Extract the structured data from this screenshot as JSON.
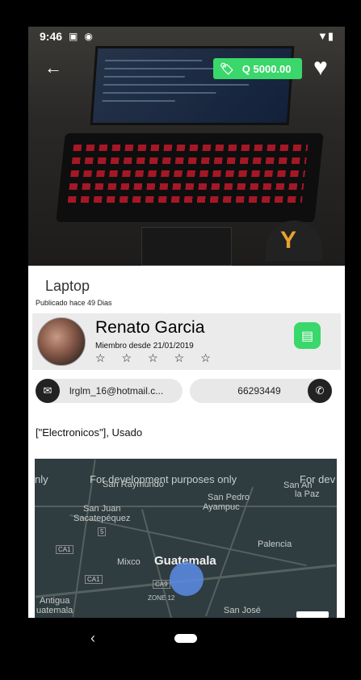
{
  "status_bar": {
    "time": "9:46",
    "icons": [
      "image-icon",
      "sync-icon"
    ],
    "right_icons": [
      "wifi-icon",
      "battery-icon"
    ]
  },
  "header": {
    "price": "Q 5000.00",
    "back_icon": "arrow-left-icon",
    "favorite_icon": "heart-icon"
  },
  "product": {
    "title": "Laptop",
    "published": "Publicado hace 49 Dias",
    "details": "[\"Electronicos\"], Usado"
  },
  "seller": {
    "name": "Renato Garcia",
    "member_since": "Miembro desde 21/01/2019",
    "stars": "☆☆☆☆☆",
    "rating_out_of": 5,
    "rating": 0
  },
  "contact": {
    "email": "lrglm_16@hotmail.c...",
    "phone": "66293449"
  },
  "map": {
    "dev_notice": "For development purposes only",
    "labels": {
      "san_raymundo": "San Raymundo",
      "san_juan": "San Juan",
      "sacatepequez": "Sacatepéquez",
      "san_pedro": "San Pedro",
      "ayampuc": "Ayampuc",
      "la_paz": "la Paz",
      "palencia": "Palencia",
      "mixco": "Mixco",
      "guatemala": "Guatemala",
      "zone12": "ZONE 12",
      "antigua": "Antigua",
      "guatemala2": "uatemala",
      "san_jose": "San José",
      "san_anto": "San An",
      "r5": "5",
      "ca1a": "CA1",
      "ca1b": "CA1",
      "ca9": "CA9",
      "nly": "nly",
      "for_dev": "For dev"
    }
  },
  "colors": {
    "accent_green": "#3ad76a",
    "dark": "#222222"
  }
}
